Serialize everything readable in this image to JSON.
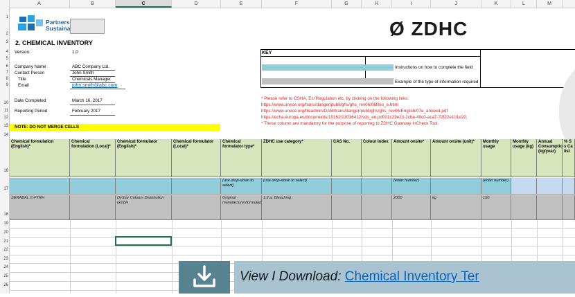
{
  "columns": [
    "A",
    "B",
    "C",
    "D",
    "E",
    "F",
    "G",
    "H",
    "I",
    "J",
    "K",
    "L",
    "M"
  ],
  "rows": {
    "top": [
      "1",
      "2",
      "3",
      "4",
      "5",
      "6",
      "7",
      "8",
      "9",
      "10",
      "11",
      "12",
      "13",
      "14"
    ],
    "header": "16",
    "instr": "17",
    "example": "18",
    "empty": [
      "19",
      "20",
      "21",
      "22",
      "23",
      "24",
      "25",
      "26"
    ]
  },
  "logo": {
    "line1": "Partnership for",
    "line2": "Sustainable Textiles"
  },
  "zdhc": "Ø ZDHC",
  "title": "2. CHEMICAL INVENTORY",
  "info": {
    "version_label": "Version:",
    "version_value": "1,0",
    "company_label": "Company Name",
    "company_value": "ABC Company Ltd.",
    "contact_label": "Contact Person",
    "contact_value": "John Smith",
    "title_label": "Title",
    "title_value": "Chemicals Manager",
    "email_label": "Email",
    "email_value": "john.smith@abc.com",
    "date_label": "Date Completed",
    "date_value": "March 16, 2017",
    "period_label": "Reporting Period",
    "period_value": "February 2017"
  },
  "note": "NOTE: DO NOT MERGE CELLS",
  "key": {
    "title": "KEY",
    "instructions": "Instructions on how to complete the field",
    "example": "Example of the type of information required",
    "notes": [
      "* Please refer to OSHA, EU Regulation etc, by clicking on the following links:",
      "https://www.unece.org/trans/danger/publi/ghs/ghs_rev06/06files_e.html",
      "https://www.unece.org/fileadmin/DAM/trans/danger/publi/ghs/ghs_rev06/English/07e_annex4.pdf",
      "https://echa.europa.eu/documents/10162/23036412/sds_en.pdf/01c29e23-2cbe-49c0-aca7-72f22e101e20,",
      "* These column are mandatory for the purpose of reporting to ZDHC Gateway InCheck Tool."
    ]
  },
  "table": {
    "headers": [
      "Chemical formulation (English)*",
      "Chemical formulation (Local)*",
      "Chemical formulator (English)*",
      "Chemical formulator (Local)*",
      "Chemical formulator type*",
      "ZDHC use category*",
      "CAS No.",
      "Colour Index",
      "Amount onsite*",
      "Amount onsite (unit)*",
      "Monthly usage",
      "Monthly usage (kg)",
      "Annual Consumption (kg/year)",
      "% S s Ca list"
    ],
    "instructions": [
      "",
      "",
      "",
      "",
      "(use drop-down to select)",
      "(use drop-down to select)",
      "",
      "",
      "(enter number)",
      "",
      "(enter number)",
      "",
      "",
      ""
    ],
    "example": [
      "SERABAL C-FTRH",
      "",
      "DyStar Colours Distribution GmbH",
      "",
      "Original manufacturer/formulator",
      "1.2.a. Bleaching",
      "",
      "",
      "2000",
      "kg",
      "150",
      "",
      "",
      ""
    ]
  },
  "banner": {
    "prefix": "View I Download",
    "sep": ": ",
    "link": "Chemical Inventory Ter"
  },
  "colors": {
    "header_green": "#d8e4bc",
    "instr_blue": "#92cddc",
    "example_gray": "#c0c0c0",
    "note_yellow": "#ffff00",
    "link_blue": "#0563c1",
    "banner_bg": "#a9c4d0",
    "download_bg": "#56838f"
  }
}
